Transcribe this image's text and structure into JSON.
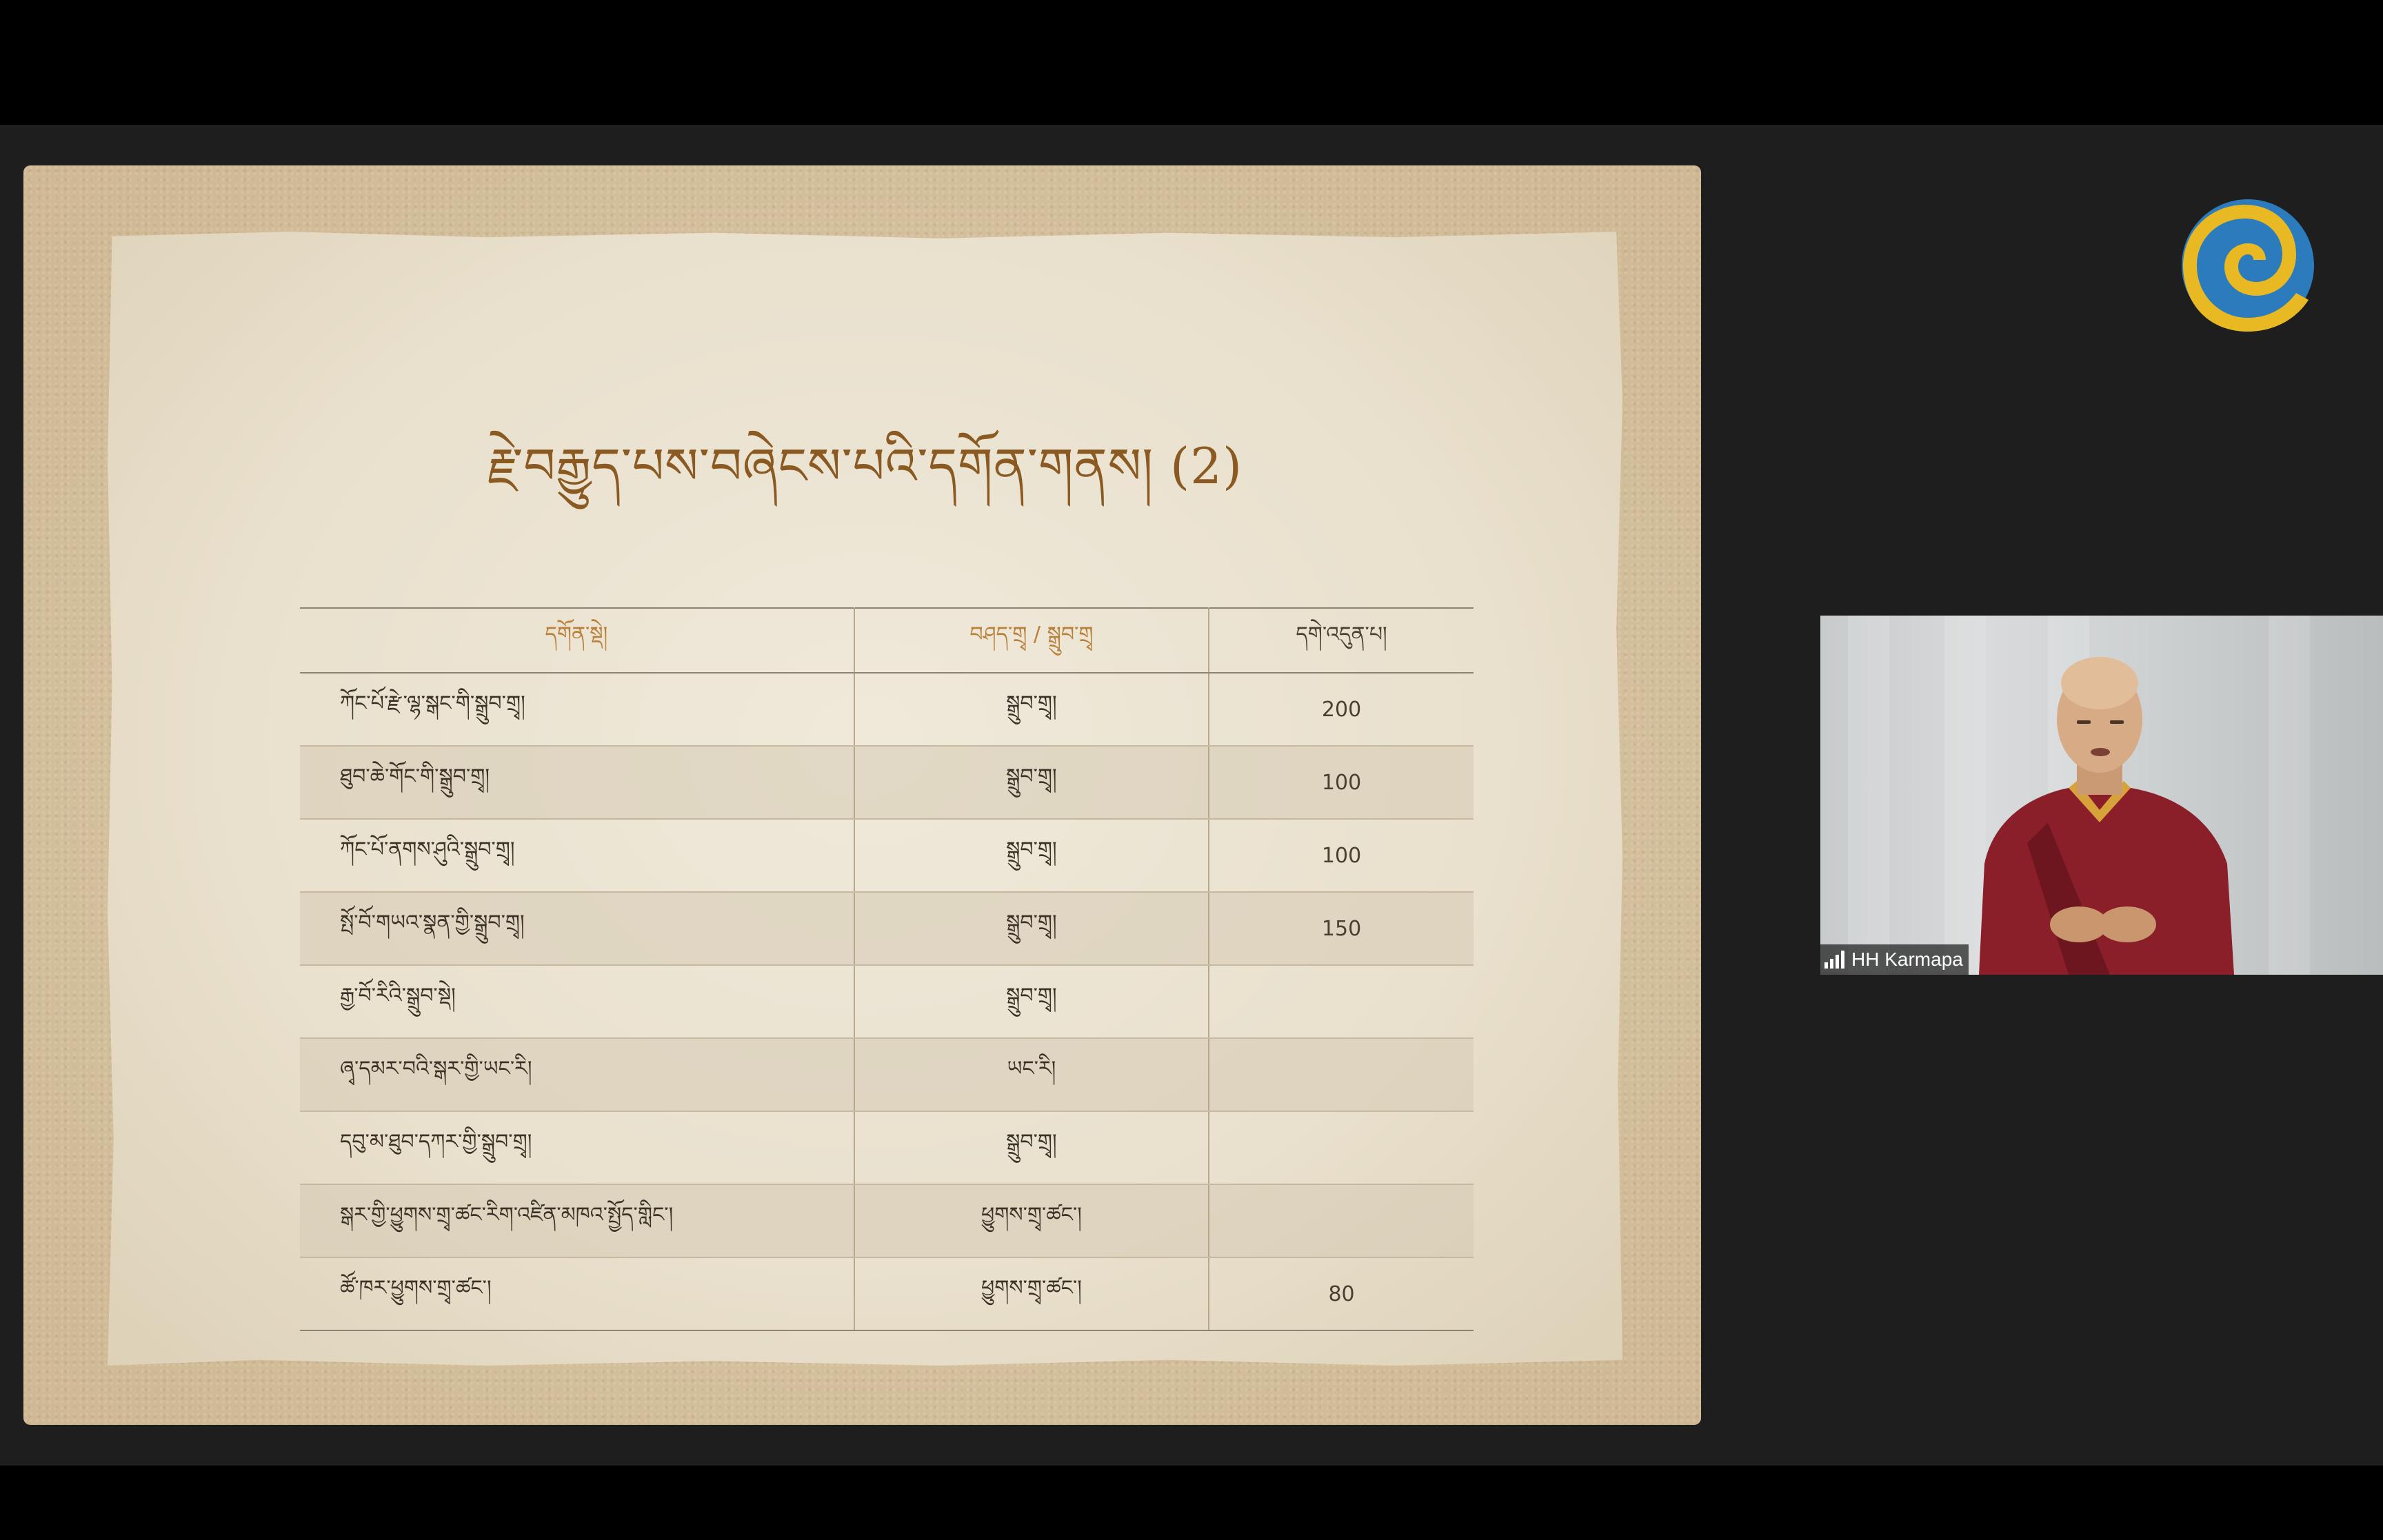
{
  "slide": {
    "title": "རྗེ་བརྒྱུད་པས་བཞེངས་པའི་དགོན་གནས། (2)",
    "table": {
      "headers": [
        "དགོན་སྡེ།",
        "བཤད་གྲྭ / སྒྲུབ་གྲྭ",
        "དགེ་འདུན་པ།"
      ],
      "rows": [
        {
          "name": "ཀོང་པོ་རྫེ་ལྷ་སྒང་གི་སྒྲུབ་གྲྭ།",
          "type": "སྒྲུབ་གྲྭ།",
          "count": "200"
        },
        {
          "name": "ཐུབ་ཆེ་གོང་གི་སྒྲུབ་གྲྭ།",
          "type": "སྒྲུབ་གྲྭ།",
          "count": "100"
        },
        {
          "name": "ཀོང་པོ་ནགས་ཤུའི་སྒྲུབ་གྲྭ།",
          "type": "སྒྲུབ་གྲྭ།",
          "count": "100"
        },
        {
          "name": "སྤོ་བོ་གཡའ་སྣན་གྱི་སྒྲུབ་གྲྭ།",
          "type": "སྒྲུབ་གྲྭ།",
          "count": "150"
        },
        {
          "name": "རྒྱ་བོ་རིའི་སྒྲུབ་སྡེ།",
          "type": "སྒྲུབ་གྲྭ།",
          "count": ""
        },
        {
          "name": "ཞྭ་དམར་བའི་སྒར་གྱི་ཡང་རི།",
          "type": "ཡང་རི།",
          "count": ""
        },
        {
          "name": "དབུ་མ་ཐུབ་དཀར་གྱི་སྒྲུབ་གྲྭ།",
          "type": "སྒྲུབ་གྲྭ།",
          "count": ""
        },
        {
          "name": "སྒར་གྱི་ཕྱུགས་གྲྭ་ཚང་རིག་འཛིན་མཁའ་སྤྱོད་གླིང་།",
          "type": "ཕྱུགས་གྲྭ་ཚང་།",
          "count": ""
        },
        {
          "name": "ཚོ་ཁར་ཕྱུགས་གྲྭ་ཚང་།",
          "type": "ཕྱུགས་གྲྭ་ཚང་།",
          "count": "80"
        }
      ]
    }
  },
  "logo": {
    "icon": "spiral-logo-icon",
    "colors": [
      "#2b7bbd",
      "#e8b923"
    ]
  },
  "participant": {
    "name": "HH Karmapa",
    "icon": "signal-strength-icon"
  },
  "colors": {
    "background": "#000000",
    "meeting_area": "#1e1e1e",
    "title_color": "#8a5a22",
    "header_color": "#b8803a"
  }
}
